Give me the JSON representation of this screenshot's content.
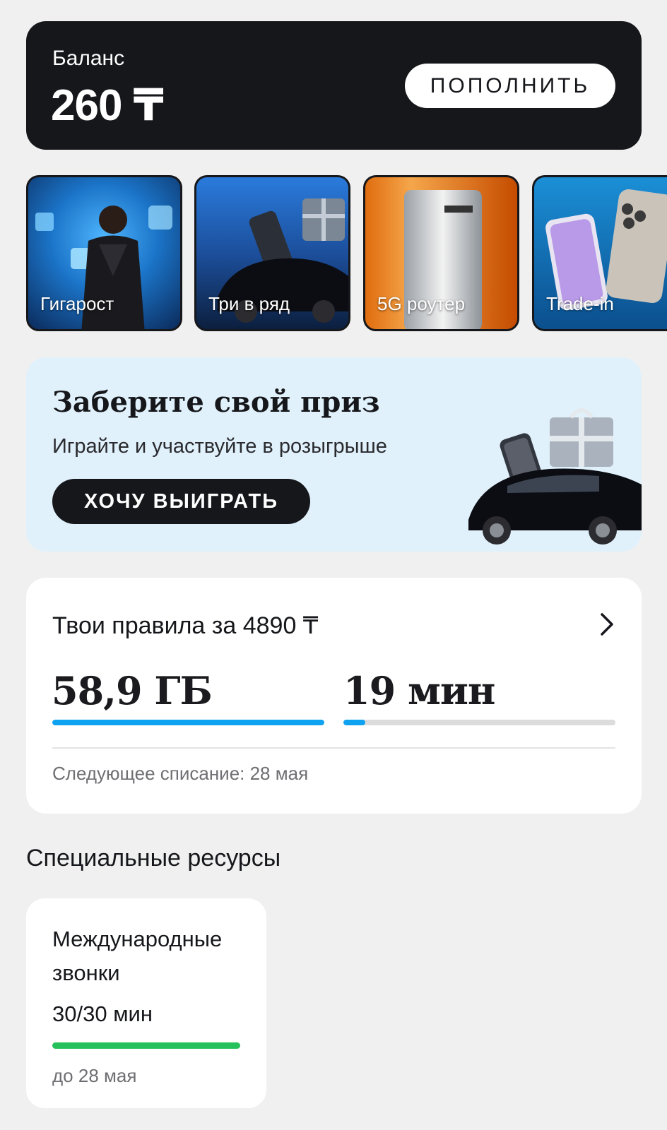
{
  "balance": {
    "label": "Баланс",
    "amount": "260 ₸",
    "topup_label": "ПОПОЛНИТЬ"
  },
  "stories": [
    {
      "label": "Гигарост"
    },
    {
      "label": "Три в ряд"
    },
    {
      "label": "5G роутер"
    },
    {
      "label": "Trade-in"
    }
  ],
  "promo": {
    "title": "Заберите свой приз",
    "subtitle": "Играйте и участвуйте в розыгрыше",
    "button_label": "ХОЧУ ВЫИГРАТЬ"
  },
  "tariff": {
    "title": "Твои правила за 4890 ₸",
    "data_value": "58,9 ГБ",
    "data_progress": 1.0,
    "minutes_value": "19 мин",
    "minutes_progress": 0.08,
    "next_charge": "Следующее списание: 28 мая"
  },
  "special": {
    "section_title": "Специальные ресурсы",
    "items": [
      {
        "title": "Международные звонки",
        "value": "30/30 мин",
        "progress": 1.0,
        "until": "до 28 мая"
      }
    ]
  },
  "colors": {
    "accent_blue": "#0fa2f0",
    "accent_green": "#25c25b",
    "dark": "#16171b"
  }
}
